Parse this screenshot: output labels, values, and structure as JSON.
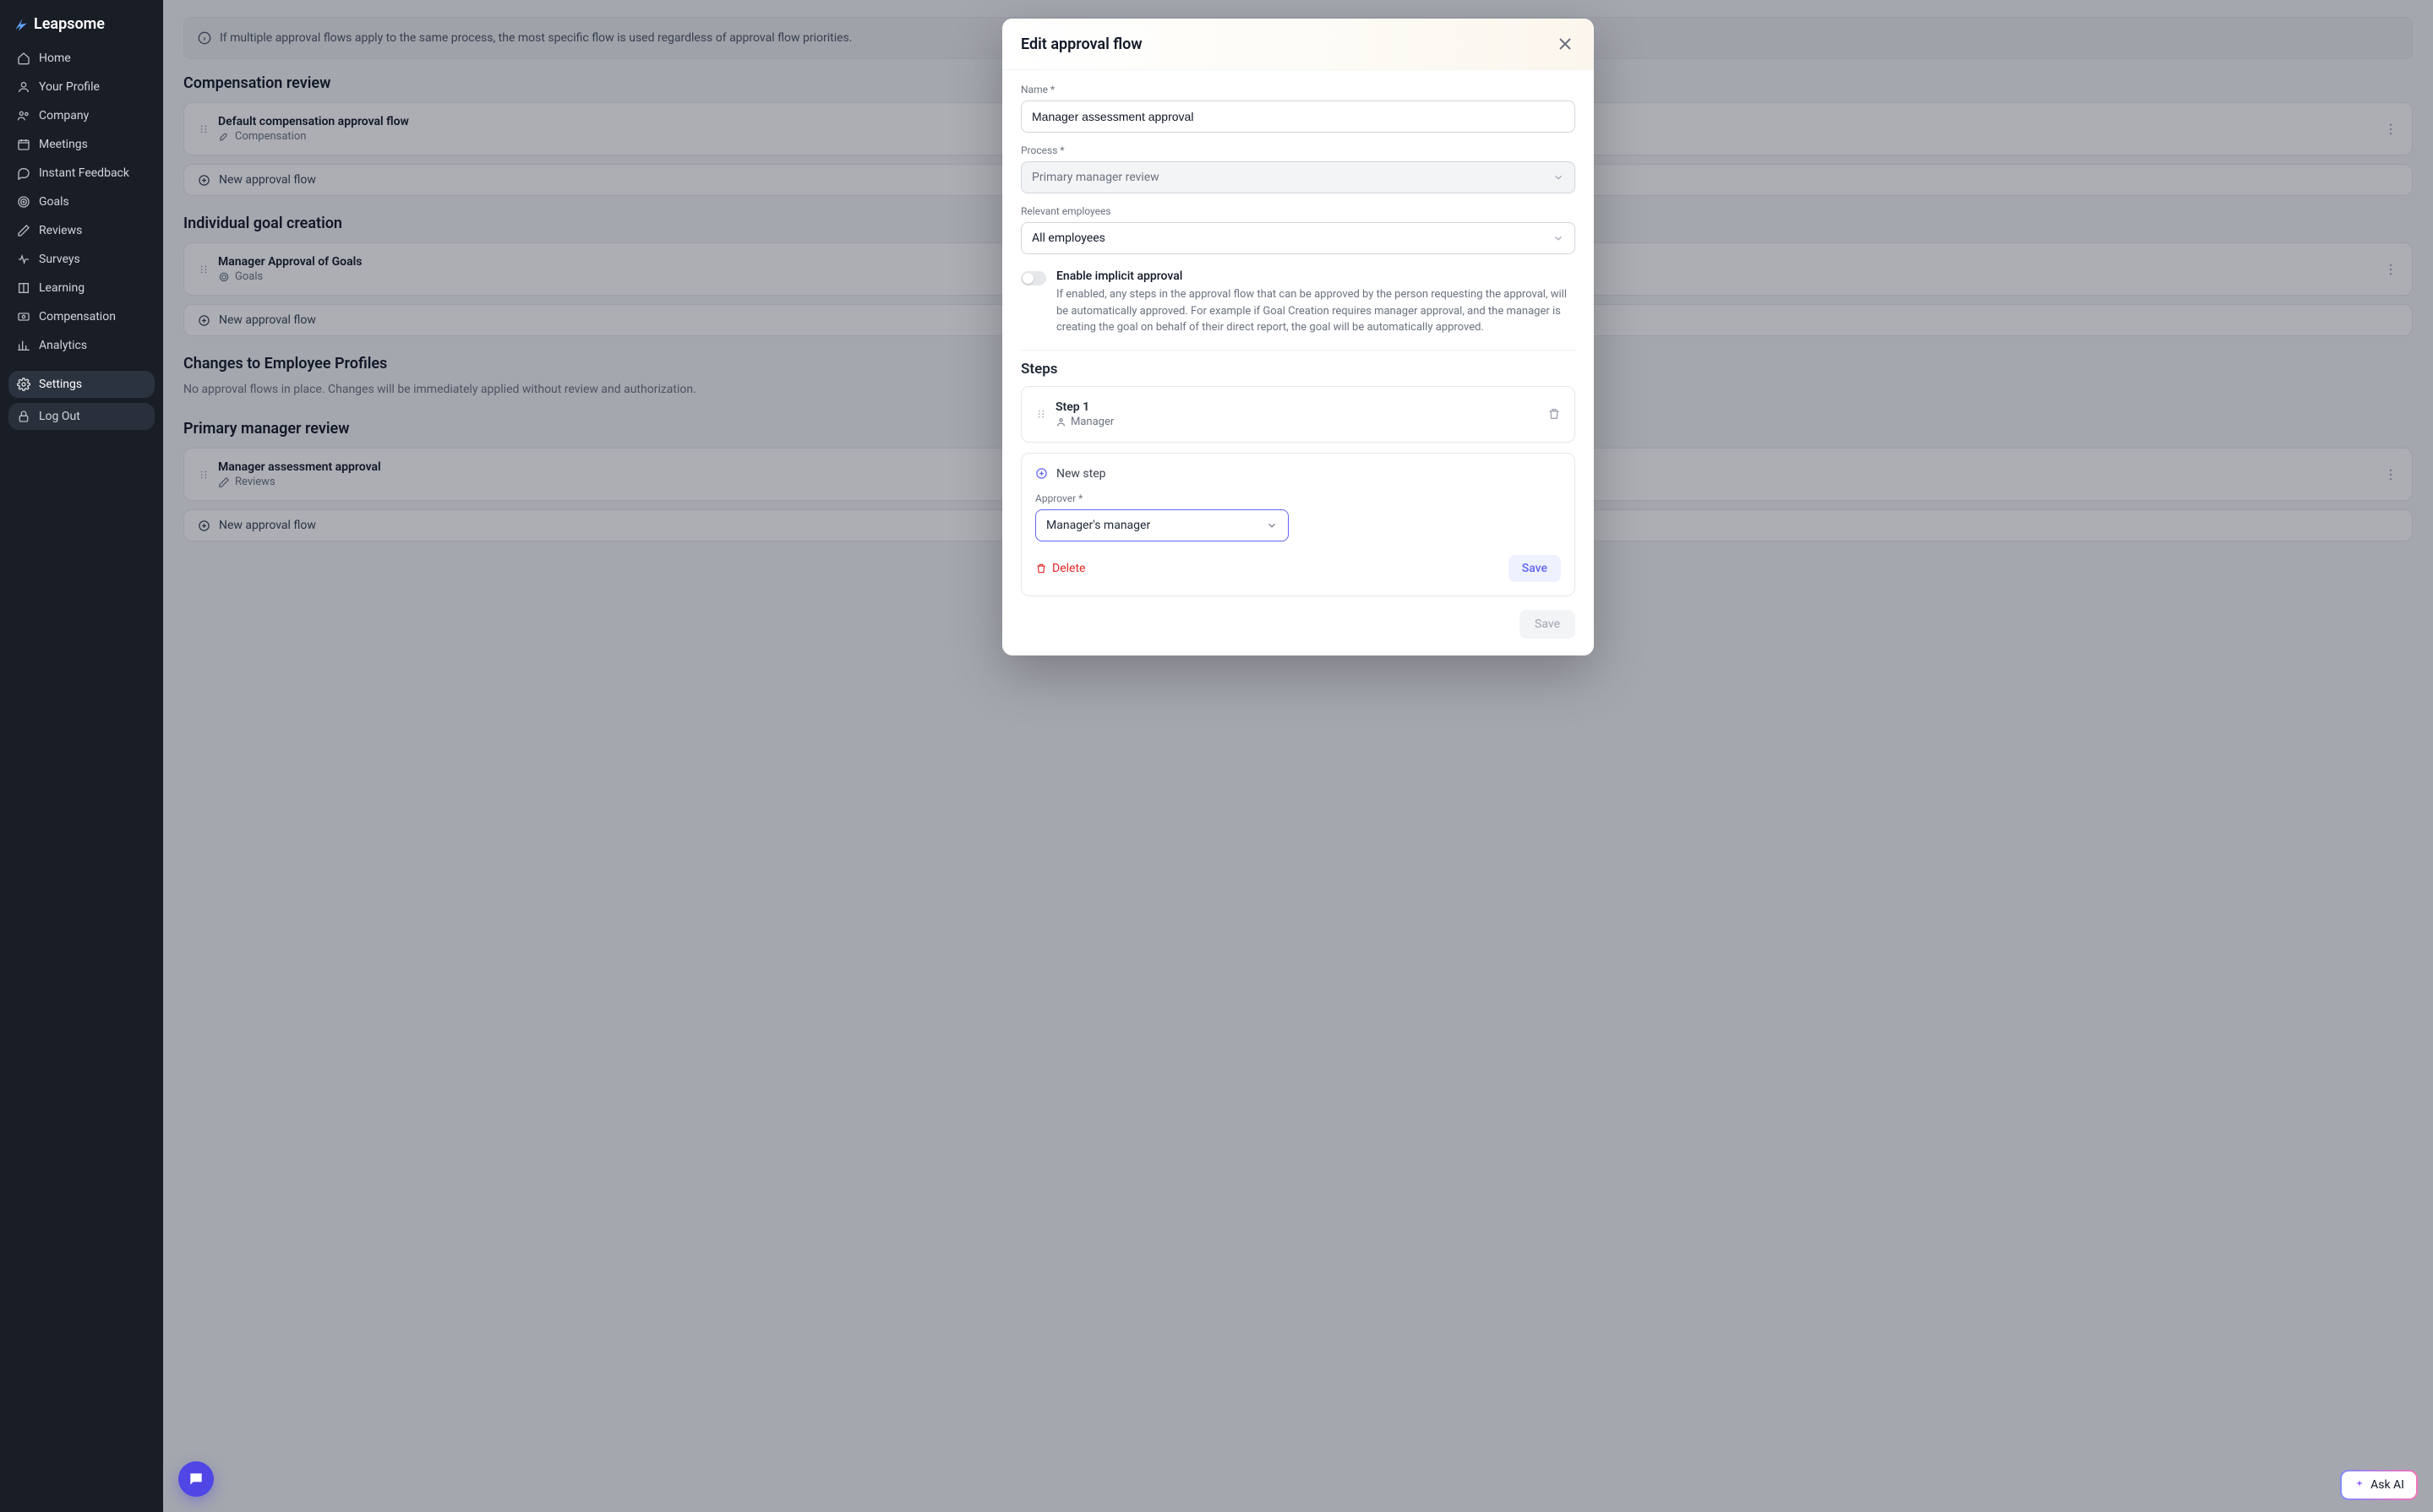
{
  "brand": "Leapsome",
  "nav": {
    "items": [
      {
        "label": "Home",
        "icon": "home-icon"
      },
      {
        "label": "Your Profile",
        "icon": "user-icon"
      },
      {
        "label": "Company",
        "icon": "users-icon"
      },
      {
        "label": "Meetings",
        "icon": "calendar-icon"
      },
      {
        "label": "Instant Feedback",
        "icon": "chat-icon"
      },
      {
        "label": "Goals",
        "icon": "target-icon"
      },
      {
        "label": "Reviews",
        "icon": "pencil-icon"
      },
      {
        "label": "Surveys",
        "icon": "heartbeat-icon"
      },
      {
        "label": "Learning",
        "icon": "book-icon"
      },
      {
        "label": "Compensation",
        "icon": "money-icon"
      },
      {
        "label": "Analytics",
        "icon": "chart-icon"
      }
    ],
    "bottom": [
      {
        "label": "Settings",
        "icon": "gear-icon"
      },
      {
        "label": "Log Out",
        "icon": "lock-icon"
      }
    ]
  },
  "page": {
    "info": "If multiple approval flows apply to the same process, the most specific flow is used regardless of approval flow priorities.",
    "sections": {
      "comp": {
        "title": "Compensation review",
        "card": {
          "title": "Default compensation approval flow",
          "sub": "Compensation"
        }
      },
      "goals": {
        "title": "Individual goal creation",
        "card": {
          "title": "Manager Approval of Goals",
          "sub": "Goals"
        }
      },
      "changes": {
        "title": "Changes to Employee Profiles",
        "desc": "No approval flows in place. Changes will be immediately applied without review and authorization."
      },
      "pmr": {
        "title": "Primary manager review",
        "card": {
          "title": "Manager assessment approval",
          "sub": "Reviews"
        }
      }
    },
    "new_flow": "New approval flow"
  },
  "modal": {
    "title": "Edit approval flow",
    "name_label": "Name *",
    "name_value": "Manager assessment approval",
    "process_label": "Process *",
    "process_value": "Primary manager review",
    "relevant_label": "Relevant employees",
    "relevant_value": "All employees",
    "toggle_title": "Enable implicit approval",
    "toggle_desc": "If enabled, any steps in the approval flow that can be approved by the person requesting the approval, will be automatically approved. For example if Goal Creation requires manager approval, and the manager is creating the goal on behalf of their direct report, the goal will be automatically approved.",
    "steps_title": "Steps",
    "step1": {
      "title": "Step 1",
      "role": "Manager"
    },
    "new_step": "New step",
    "approver_label": "Approver *",
    "approver_value": "Manager's manager",
    "delete": "Delete",
    "save_step": "Save",
    "save": "Save"
  },
  "ask_ai": "Ask AI"
}
